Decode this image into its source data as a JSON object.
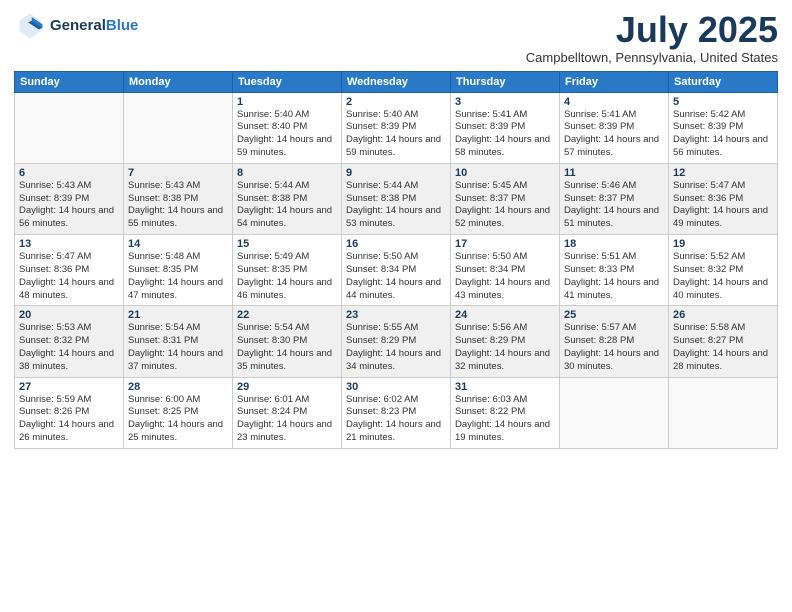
{
  "logo": {
    "line1": "General",
    "line2": "Blue"
  },
  "header": {
    "month": "July 2025",
    "location": "Campbelltown, Pennsylvania, United States"
  },
  "days_of_week": [
    "Sunday",
    "Monday",
    "Tuesday",
    "Wednesday",
    "Thursday",
    "Friday",
    "Saturday"
  ],
  "weeks": [
    [
      {
        "day": "",
        "sunrise": "",
        "sunset": "",
        "daylight": ""
      },
      {
        "day": "",
        "sunrise": "",
        "sunset": "",
        "daylight": ""
      },
      {
        "day": "1",
        "sunrise": "Sunrise: 5:40 AM",
        "sunset": "Sunset: 8:40 PM",
        "daylight": "Daylight: 14 hours and 59 minutes."
      },
      {
        "day": "2",
        "sunrise": "Sunrise: 5:40 AM",
        "sunset": "Sunset: 8:39 PM",
        "daylight": "Daylight: 14 hours and 59 minutes."
      },
      {
        "day": "3",
        "sunrise": "Sunrise: 5:41 AM",
        "sunset": "Sunset: 8:39 PM",
        "daylight": "Daylight: 14 hours and 58 minutes."
      },
      {
        "day": "4",
        "sunrise": "Sunrise: 5:41 AM",
        "sunset": "Sunset: 8:39 PM",
        "daylight": "Daylight: 14 hours and 57 minutes."
      },
      {
        "day": "5",
        "sunrise": "Sunrise: 5:42 AM",
        "sunset": "Sunset: 8:39 PM",
        "daylight": "Daylight: 14 hours and 56 minutes."
      }
    ],
    [
      {
        "day": "6",
        "sunrise": "Sunrise: 5:43 AM",
        "sunset": "Sunset: 8:39 PM",
        "daylight": "Daylight: 14 hours and 56 minutes."
      },
      {
        "day": "7",
        "sunrise": "Sunrise: 5:43 AM",
        "sunset": "Sunset: 8:38 PM",
        "daylight": "Daylight: 14 hours and 55 minutes."
      },
      {
        "day": "8",
        "sunrise": "Sunrise: 5:44 AM",
        "sunset": "Sunset: 8:38 PM",
        "daylight": "Daylight: 14 hours and 54 minutes."
      },
      {
        "day": "9",
        "sunrise": "Sunrise: 5:44 AM",
        "sunset": "Sunset: 8:38 PM",
        "daylight": "Daylight: 14 hours and 53 minutes."
      },
      {
        "day": "10",
        "sunrise": "Sunrise: 5:45 AM",
        "sunset": "Sunset: 8:37 PM",
        "daylight": "Daylight: 14 hours and 52 minutes."
      },
      {
        "day": "11",
        "sunrise": "Sunrise: 5:46 AM",
        "sunset": "Sunset: 8:37 PM",
        "daylight": "Daylight: 14 hours and 51 minutes."
      },
      {
        "day": "12",
        "sunrise": "Sunrise: 5:47 AM",
        "sunset": "Sunset: 8:36 PM",
        "daylight": "Daylight: 14 hours and 49 minutes."
      }
    ],
    [
      {
        "day": "13",
        "sunrise": "Sunrise: 5:47 AM",
        "sunset": "Sunset: 8:36 PM",
        "daylight": "Daylight: 14 hours and 48 minutes."
      },
      {
        "day": "14",
        "sunrise": "Sunrise: 5:48 AM",
        "sunset": "Sunset: 8:35 PM",
        "daylight": "Daylight: 14 hours and 47 minutes."
      },
      {
        "day": "15",
        "sunrise": "Sunrise: 5:49 AM",
        "sunset": "Sunset: 8:35 PM",
        "daylight": "Daylight: 14 hours and 46 minutes."
      },
      {
        "day": "16",
        "sunrise": "Sunrise: 5:50 AM",
        "sunset": "Sunset: 8:34 PM",
        "daylight": "Daylight: 14 hours and 44 minutes."
      },
      {
        "day": "17",
        "sunrise": "Sunrise: 5:50 AM",
        "sunset": "Sunset: 8:34 PM",
        "daylight": "Daylight: 14 hours and 43 minutes."
      },
      {
        "day": "18",
        "sunrise": "Sunrise: 5:51 AM",
        "sunset": "Sunset: 8:33 PM",
        "daylight": "Daylight: 14 hours and 41 minutes."
      },
      {
        "day": "19",
        "sunrise": "Sunrise: 5:52 AM",
        "sunset": "Sunset: 8:32 PM",
        "daylight": "Daylight: 14 hours and 40 minutes."
      }
    ],
    [
      {
        "day": "20",
        "sunrise": "Sunrise: 5:53 AM",
        "sunset": "Sunset: 8:32 PM",
        "daylight": "Daylight: 14 hours and 38 minutes."
      },
      {
        "day": "21",
        "sunrise": "Sunrise: 5:54 AM",
        "sunset": "Sunset: 8:31 PM",
        "daylight": "Daylight: 14 hours and 37 minutes."
      },
      {
        "day": "22",
        "sunrise": "Sunrise: 5:54 AM",
        "sunset": "Sunset: 8:30 PM",
        "daylight": "Daylight: 14 hours and 35 minutes."
      },
      {
        "day": "23",
        "sunrise": "Sunrise: 5:55 AM",
        "sunset": "Sunset: 8:29 PM",
        "daylight": "Daylight: 14 hours and 34 minutes."
      },
      {
        "day": "24",
        "sunrise": "Sunrise: 5:56 AM",
        "sunset": "Sunset: 8:29 PM",
        "daylight": "Daylight: 14 hours and 32 minutes."
      },
      {
        "day": "25",
        "sunrise": "Sunrise: 5:57 AM",
        "sunset": "Sunset: 8:28 PM",
        "daylight": "Daylight: 14 hours and 30 minutes."
      },
      {
        "day": "26",
        "sunrise": "Sunrise: 5:58 AM",
        "sunset": "Sunset: 8:27 PM",
        "daylight": "Daylight: 14 hours and 28 minutes."
      }
    ],
    [
      {
        "day": "27",
        "sunrise": "Sunrise: 5:59 AM",
        "sunset": "Sunset: 8:26 PM",
        "daylight": "Daylight: 14 hours and 26 minutes."
      },
      {
        "day": "28",
        "sunrise": "Sunrise: 6:00 AM",
        "sunset": "Sunset: 8:25 PM",
        "daylight": "Daylight: 14 hours and 25 minutes."
      },
      {
        "day": "29",
        "sunrise": "Sunrise: 6:01 AM",
        "sunset": "Sunset: 8:24 PM",
        "daylight": "Daylight: 14 hours and 23 minutes."
      },
      {
        "day": "30",
        "sunrise": "Sunrise: 6:02 AM",
        "sunset": "Sunset: 8:23 PM",
        "daylight": "Daylight: 14 hours and 21 minutes."
      },
      {
        "day": "31",
        "sunrise": "Sunrise: 6:03 AM",
        "sunset": "Sunset: 8:22 PM",
        "daylight": "Daylight: 14 hours and 19 minutes."
      },
      {
        "day": "",
        "sunrise": "",
        "sunset": "",
        "daylight": ""
      },
      {
        "day": "",
        "sunrise": "",
        "sunset": "",
        "daylight": ""
      }
    ]
  ]
}
